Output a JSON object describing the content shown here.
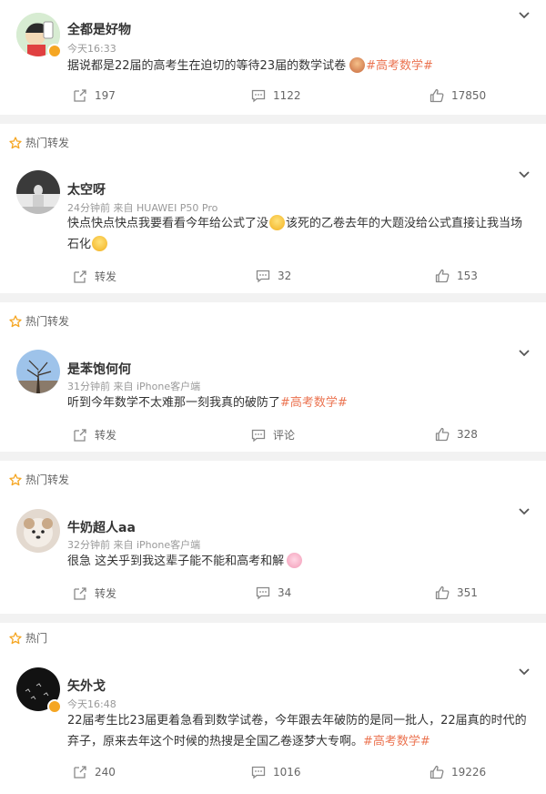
{
  "posts": [
    {
      "author": "全都是好物",
      "time": "今天16:33",
      "text": "据说都是22届的高考生在迫切的等待23届的数学试卷",
      "tag": "#高考数学#",
      "actions": {
        "share": "197",
        "comment": "1122",
        "like": "17850"
      }
    },
    {
      "header": "热门转发",
      "author": "太空呀",
      "meta": "24分钟前  来自 HUAWEI P50 Pro",
      "text_1": "快点快点快点我要看看今年给公式了没",
      "text_2": "该死的乙卷去年的大题没给公式直接让我当场",
      "text_3": "石化",
      "actions": {
        "share": "转发",
        "comment": "32",
        "like": "153"
      }
    },
    {
      "header": "热门转发",
      "author": "是苯饱何何",
      "meta": "31分钟前  来自 iPhone客户端",
      "text": "听到今年数学不太难那一刻我真的破防了",
      "tag": "#高考数学#",
      "actions": {
        "share": "转发",
        "comment": "评论",
        "like": "328"
      }
    },
    {
      "header": "热门转发",
      "author": "牛奶超人aa",
      "meta": "32分钟前  来自 iPhone客户端",
      "text": "很急 这关乎到我这辈子能不能和高考和解",
      "actions": {
        "share": "转发",
        "comment": "34",
        "like": "351"
      }
    },
    {
      "header": "热门",
      "author": "矢外戈",
      "time": "今天16:48",
      "text_1": "22届考生比23届更着急看到数学试卷，今年跟去年破防的是同一批人，22届真的时代的",
      "text_2": "弃子，原来去年这个时候的热搜是全国乙卷逐梦大专啊。",
      "tag": "#高考数学#",
      "actions": {
        "share": "240",
        "comment": "1016",
        "like": "19226"
      }
    }
  ],
  "icons": {
    "share": "share-icon",
    "comment": "comment-icon",
    "like": "thumbs-up-icon",
    "menu": "chevron-down-icon",
    "hot": "star-icon"
  },
  "colors": {
    "tag": "#eb7350",
    "badge": "#f5a623",
    "separator": "#f2f2f2"
  }
}
